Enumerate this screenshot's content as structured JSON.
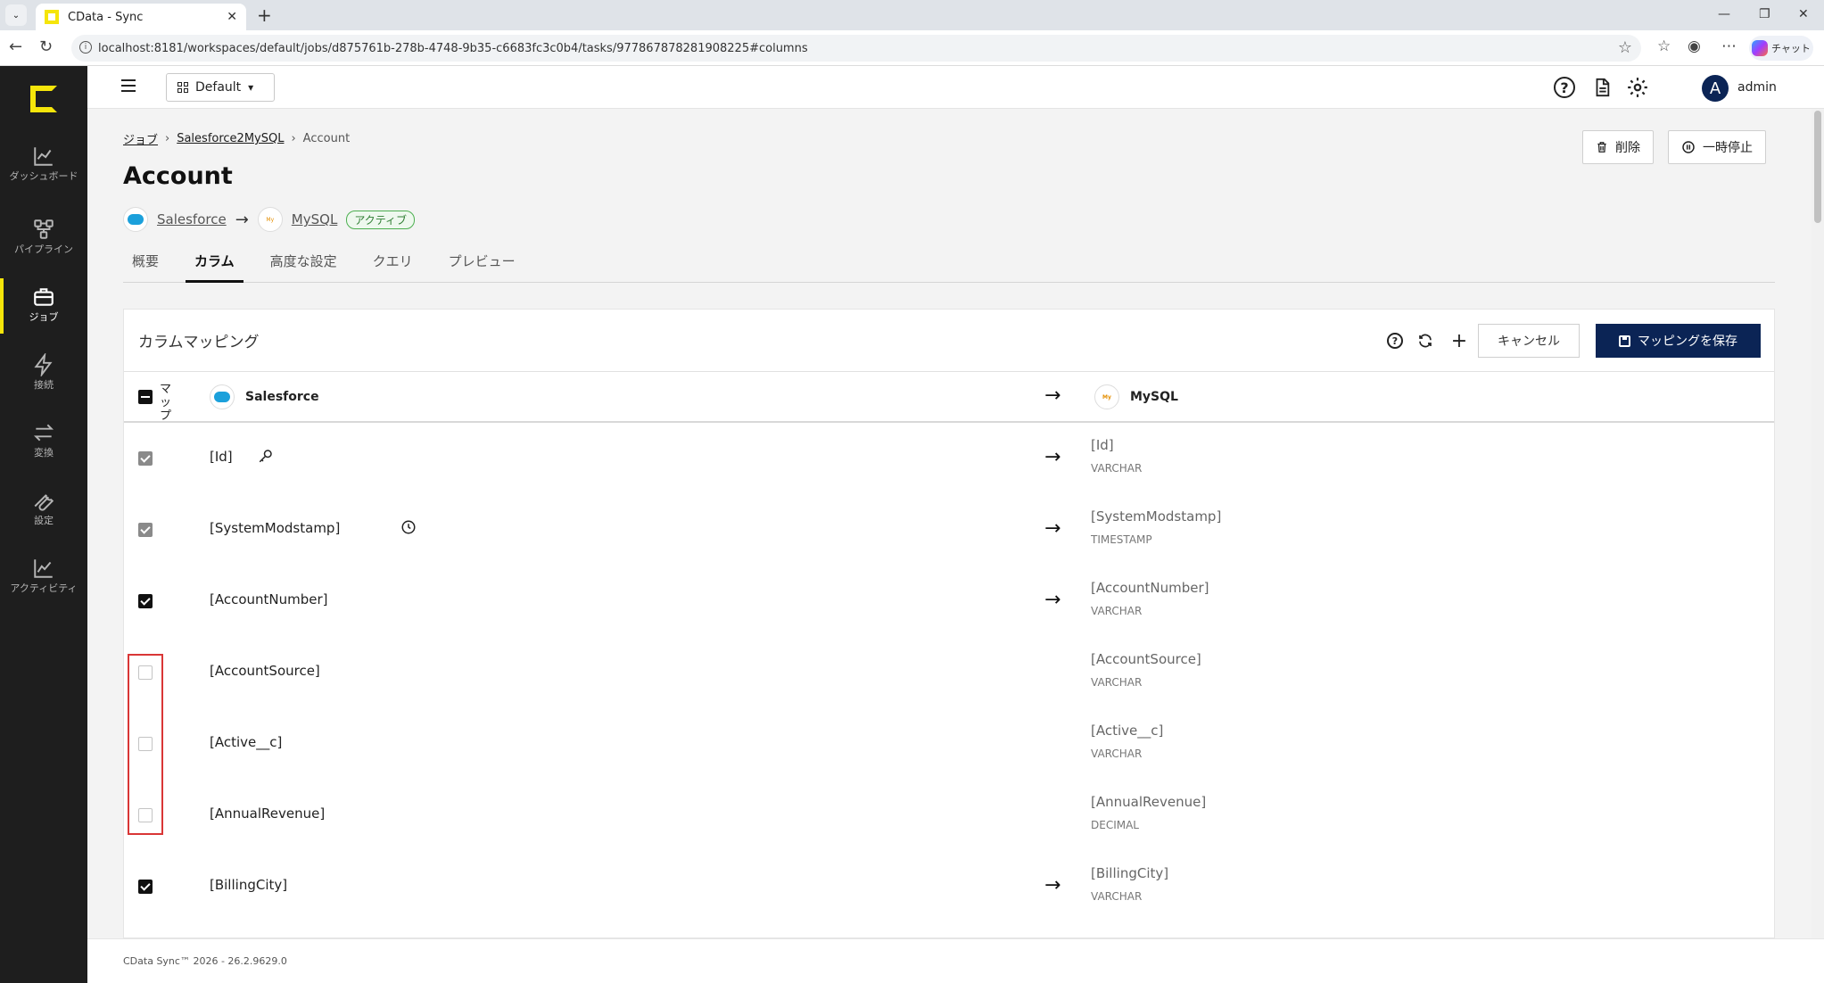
{
  "browser": {
    "tab_title": "CData - Sync",
    "tab_close": "✕",
    "new_tab": "+",
    "url": "localhost:8181/workspaces/default/jobs/d875761b-278b-4748-9b35-c6683fc3c0b4/tasks/977867878281908225#columns",
    "copilot_label": "チャット"
  },
  "sidebar": {
    "items": [
      {
        "label": "ダッシュボード",
        "icon": "chart-line-icon"
      },
      {
        "label": "パイプライン",
        "icon": "pipeline-icon"
      },
      {
        "label": "ジョブ",
        "icon": "briefcase-icon",
        "active": true
      },
      {
        "label": "接続",
        "icon": "lightning-icon"
      },
      {
        "label": "変換",
        "icon": "arrows-exchange-icon"
      },
      {
        "label": "設定",
        "icon": "wrench-icon"
      },
      {
        "label": "アクティビティ",
        "icon": "activity-icon"
      }
    ]
  },
  "header": {
    "workspace": "Default",
    "user": "admin",
    "avatar_initial": "A"
  },
  "breadcrumb": {
    "jobs": "ジョブ",
    "job": "Salesforce2MySQL",
    "current": "Account",
    "sep": "›"
  },
  "page": {
    "title": "Account",
    "delete_label": "削除",
    "pause_label": "一時停止",
    "source": "Salesforce",
    "destination": "MySQL",
    "status": "アクティブ"
  },
  "tabs": [
    "概要",
    "カラム",
    "高度な設定",
    "クエリ",
    "プレビュー"
  ],
  "mapping": {
    "title": "カラムマッピング",
    "cancel_label": "キャンセル",
    "save_label": "マッピングを保存",
    "map_header": "マップ",
    "source_header": "Salesforce",
    "dest_header": "MySQL",
    "rows": [
      {
        "src": "[Id]",
        "dst": "[Id]",
        "type": "VARCHAR",
        "state": "locked",
        "icon": "key-icon"
      },
      {
        "src": "[SystemModstamp]",
        "dst": "[SystemModstamp]",
        "type": "TIMESTAMP",
        "state": "locked",
        "icon": "clock-icon"
      },
      {
        "src": "[AccountNumber]",
        "dst": "[AccountNumber]",
        "type": "VARCHAR",
        "state": "on"
      },
      {
        "src": "[AccountSource]",
        "dst": "[AccountSource]",
        "type": "VARCHAR",
        "state": "off"
      },
      {
        "src": "[Active__c]",
        "dst": "[Active__c]",
        "type": "VARCHAR",
        "state": "off"
      },
      {
        "src": "[AnnualRevenue]",
        "dst": "[AnnualRevenue]",
        "type": "DECIMAL",
        "state": "off"
      },
      {
        "src": "[BillingCity]",
        "dst": "[BillingCity]",
        "type": "VARCHAR",
        "state": "on"
      }
    ]
  },
  "footer": {
    "version": "CData Sync™ 2026 - 26.2.9629.0"
  },
  "colors": {
    "accent": "#f5e50a",
    "primary": "#0b2455",
    "highlight": "#d93636"
  }
}
